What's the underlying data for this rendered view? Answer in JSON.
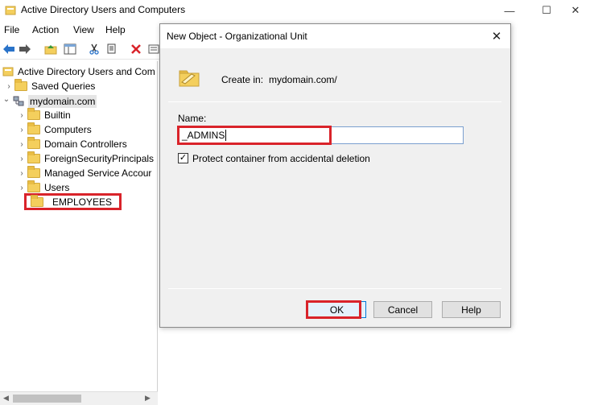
{
  "window": {
    "title": "Active Directory Users and Computers",
    "controls": [
      "—",
      "☐",
      "✕"
    ]
  },
  "menu": [
    "File",
    "Action",
    "View",
    "Help"
  ],
  "toolbar": {
    "icons": [
      "back-arrow-icon",
      "forward-arrow-icon",
      "up-folder-icon",
      "show-console-tree-icon",
      "cut-icon",
      "copy-icon",
      "delete-icon",
      "properties-icon"
    ]
  },
  "tree": {
    "root": "Active Directory Users and Com",
    "items": [
      {
        "label": "Saved Queries",
        "chevron": "›"
      },
      {
        "label": "mydomain.com",
        "chevron": "⌄"
      },
      {
        "label": "Builtin",
        "chevron": "›"
      },
      {
        "label": "Computers",
        "chevron": "›"
      },
      {
        "label": "Domain Controllers",
        "chevron": "›"
      },
      {
        "label": "ForeignSecurityPrincipals",
        "chevron": "›"
      },
      {
        "label": "Managed Service Accour",
        "chevron": "›"
      },
      {
        "label": "Users",
        "chevron": "›"
      },
      {
        "label": "EMPLOYEES",
        "chevron": ""
      }
    ]
  },
  "dialog": {
    "title": "New Object - Organizational Unit",
    "close": "✕",
    "create_in_label": "Create in:",
    "create_in_value": "mydomain.com/",
    "name_label": "Name:",
    "name_value": "_ADMINS",
    "protect_label": "Protect container from accidental deletion",
    "protect_checked_glyph": "✓",
    "ok_label": "OK",
    "cancel_label": "Cancel",
    "help_label": "Help"
  },
  "colors": {
    "highlight_red": "#d9232a",
    "focus_blue": "#0078d7",
    "folder_yellow": "#f4cf5d"
  }
}
